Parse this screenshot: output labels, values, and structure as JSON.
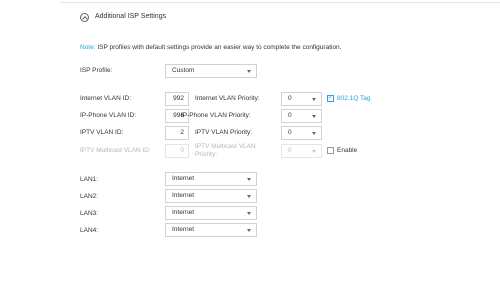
{
  "section": {
    "title": "Additional ISP Settings",
    "icon": "collapse-circle-icon"
  },
  "note": {
    "label": "Note:",
    "text": " ISP profiles with default settings provide an easier way to complete the configuration."
  },
  "isp_profile": {
    "label": "ISP Profile:",
    "value": "Custom"
  },
  "internet_vlan": {
    "id_label": "Internet VLAN ID:",
    "id_value": "992",
    "priority_label": "Internet VLAN Priority:",
    "priority_value": "0",
    "tag_label": "802.1Q Tag",
    "tag_checked": true
  },
  "iphone_vlan": {
    "id_label": "IP-Phone VLAN ID:",
    "id_value": "996",
    "priority_label": "IP-Phone VLAN Priority:",
    "priority_value": "0"
  },
  "iptv_vlan": {
    "id_label": "IPTV VLAN ID:",
    "id_value": "2",
    "priority_label": "IPTV VLAN Priority:",
    "priority_value": "0"
  },
  "iptv_multicast": {
    "id_label": "IPTV Multicast VLAN ID:",
    "id_value": "0",
    "priority_label_line1": "IPTV Multicast VLAN",
    "priority_label_line2": "Priority:",
    "priority_value": "0",
    "enable_label": "Enable",
    "enable_checked": false
  },
  "lans": [
    {
      "label": "LAN1:",
      "value": "Internet"
    },
    {
      "label": "LAN2:",
      "value": "Internet"
    },
    {
      "label": "LAN3:",
      "value": "Internet"
    },
    {
      "label": "LAN4:",
      "value": "Internet"
    }
  ],
  "colors": {
    "accent": "#2aa3d6",
    "text": "#333333",
    "disabled": "#b5b5b5",
    "border": "#d2d2d2"
  }
}
